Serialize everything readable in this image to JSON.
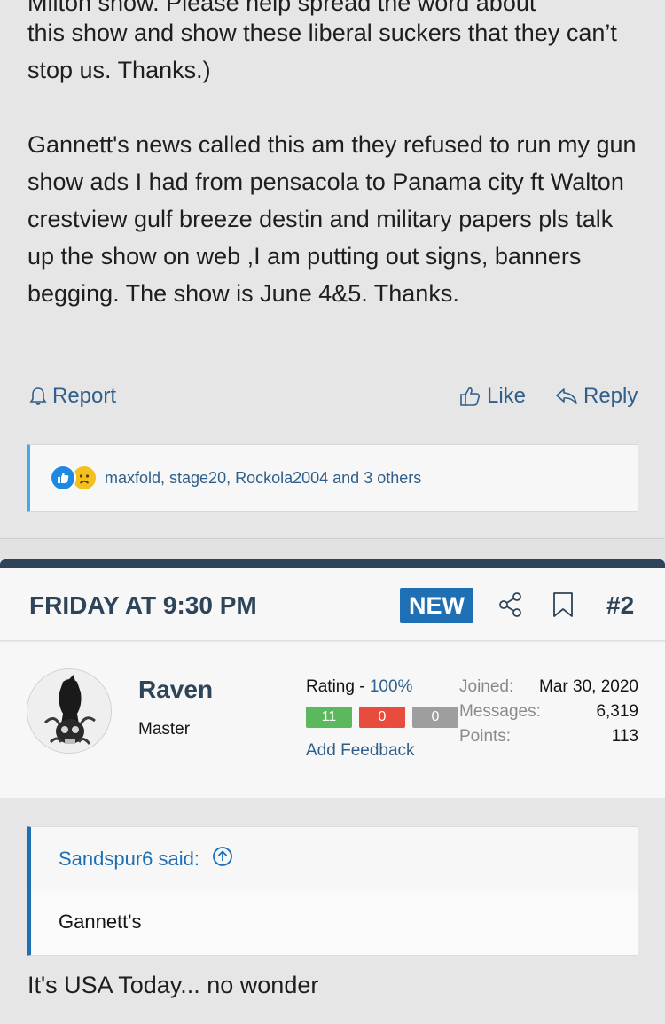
{
  "post1": {
    "cut_line": "Milton show. Please help spread the word about",
    "paragraph1": "this show and show these liberal suckers that they can’t stop us. Thanks.)",
    "paragraph2": "Gannett's news called this am they refused to run my gun show ads I had from pensacola to Panama city ft Walton crestview gulf breeze destin and military papers pls talk up the show on web ,I am putting out signs, banners begging. The show is June 4&5. Thanks.",
    "actions": {
      "report": "Report",
      "like": "Like",
      "reply": "Reply"
    },
    "reactions": {
      "icons": [
        "like-reaction-icon",
        "sad-reaction-icon"
      ],
      "users": "maxfold, stage20, Rockola2004 and 3 others"
    }
  },
  "post2": {
    "date": "FRIDAY AT 9:30 PM",
    "new_badge": "NEW",
    "post_number": "#2",
    "user": {
      "name": "Raven",
      "title": "Master",
      "rating_label": "Rating - ",
      "rating_value": "100%",
      "feedback": {
        "positive": "11",
        "negative": "0",
        "neutral": "0"
      },
      "add_feedback": "Add Feedback",
      "stats": [
        {
          "key": "Joined:",
          "value": "Mar 30, 2020"
        },
        {
          "key": "Messages:",
          "value": "6,319"
        },
        {
          "key": "Points:",
          "value": "113"
        }
      ]
    },
    "quote": {
      "author": "Sandspur6 said:",
      "text": "Gannett's"
    },
    "reply": "It's USA Today... no wonder"
  },
  "colors": {
    "accent": "#1f6fb5",
    "header_text": "#2d4459",
    "link": "#2f5f8a",
    "positive": "#5cb85c",
    "negative": "#e74c3c",
    "neutral": "#9e9e9e"
  }
}
